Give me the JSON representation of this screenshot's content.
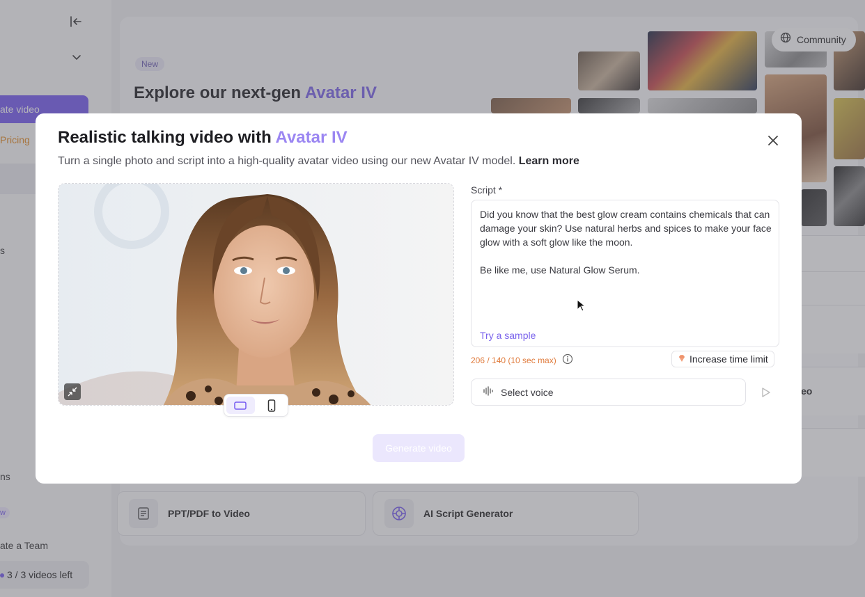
{
  "sidebar": {
    "create_video_label": "ate video",
    "pricing_label": "Pricing",
    "item_s": "s",
    "item_ns": "ns",
    "badge_w": "w",
    "team_label": "ate a Team",
    "videos_left": "3 / 3 videos left"
  },
  "hero": {
    "badge": "New",
    "title_prefix": "Explore our next-gen ",
    "title_accent": "Avatar IV",
    "community_label": "Community"
  },
  "background_rows": {
    "ppt": "PPT/PDF to Video",
    "script_gen": "AI Script Generator",
    "eo": "eo"
  },
  "modal": {
    "title_prefix": "Realistic talking video with ",
    "title_accent": "Avatar IV",
    "subtitle": "Turn a single photo and script into a high-quality avatar video using our new Avatar IV model. ",
    "learn_more": "Learn more",
    "script_label": "Script *",
    "script_text": "Did you know that the best glow cream contains chemicals that can damage your skin? Use natural herbs and spices to make your face glow with a soft glow like the moon.\n\nBe like me, use Natural Glow Serum.",
    "try_sample": "Try a sample",
    "char_count": "206 / 140 (10 sec max)",
    "increase_label": "Increase time limit",
    "voice_placeholder": "Select voice",
    "generate_label": "Generate video"
  },
  "colors": {
    "accent": "#7559f2",
    "accent_light": "#9b86f2",
    "warning": "#e07b3c",
    "pricing": "#e58a1f"
  },
  "icons": [
    "collapse-sidebar-icon",
    "chevron-down-icon",
    "globe-icon",
    "close-icon",
    "minimize-icon",
    "landscape-icon",
    "portrait-icon",
    "info-icon",
    "diamond-icon",
    "waveform-icon",
    "play-icon",
    "document-icon",
    "openai-icon",
    "cursor-icon"
  ]
}
